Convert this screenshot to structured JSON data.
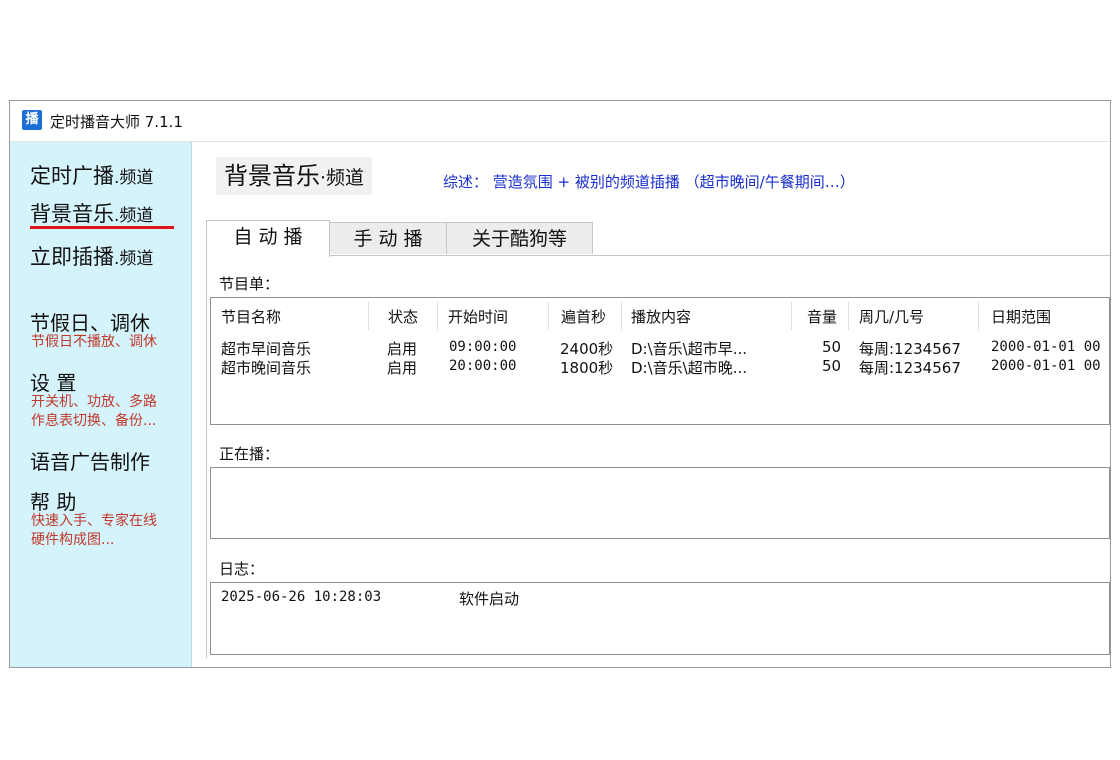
{
  "window": {
    "title": "定时播音大师 7.1.1",
    "icon_text": "播"
  },
  "sidebar": {
    "channels": [
      {
        "main": "定时广播",
        "suffix": ".频道",
        "active": false
      },
      {
        "main": "背景音乐",
        "suffix": ".频道",
        "active": true
      },
      {
        "main": "立即插播",
        "suffix": ".频道",
        "active": false
      }
    ],
    "holiday": {
      "title": "节假日、调休",
      "sub": "节假日不播放、调休"
    },
    "settings": {
      "title": "设 置",
      "sub1": "开关机、功放、多路",
      "sub2": "作息表切换、备份..."
    },
    "voice_ad": {
      "title": "语音广告制作"
    },
    "help": {
      "title": "帮 助",
      "sub1": "快速入手、专家在线",
      "sub2": "硬件构成图..."
    }
  },
  "main": {
    "heading_main": "背景音乐",
    "heading_suffix": "·频道",
    "summary": "综述： 营造氛围 + 被别的频道插播 （超市晚间/午餐期间…）",
    "tabs": [
      "自 动 播",
      "手 动 播",
      "关于酷狗等"
    ],
    "playlist_label": "节目单：",
    "columns": [
      "节目名称",
      "状态",
      "开始时间",
      "遍首秒",
      "播放内容",
      "音量",
      "周几/几号",
      "日期范围"
    ],
    "rows": [
      {
        "name": "超市早间音乐",
        "status": "启用",
        "start": "09:00:00",
        "secs": "2400秒",
        "content": "D:\\音乐\\超市早...",
        "volume": "50",
        "days": "每周:1234567",
        "range": "2000-01-01 00"
      },
      {
        "name": "超市晚间音乐",
        "status": "启用",
        "start": "20:00:00",
        "secs": "1800秒",
        "content": "D:\\音乐\\超市晚...",
        "volume": "50",
        "days": "每周:1234567",
        "range": "2000-01-01 00"
      }
    ],
    "now_playing_label": "正在播：",
    "log_label": "日志：",
    "log": [
      {
        "time": "2025-06-26 10:28:03",
        "message": "软件启动"
      }
    ]
  }
}
